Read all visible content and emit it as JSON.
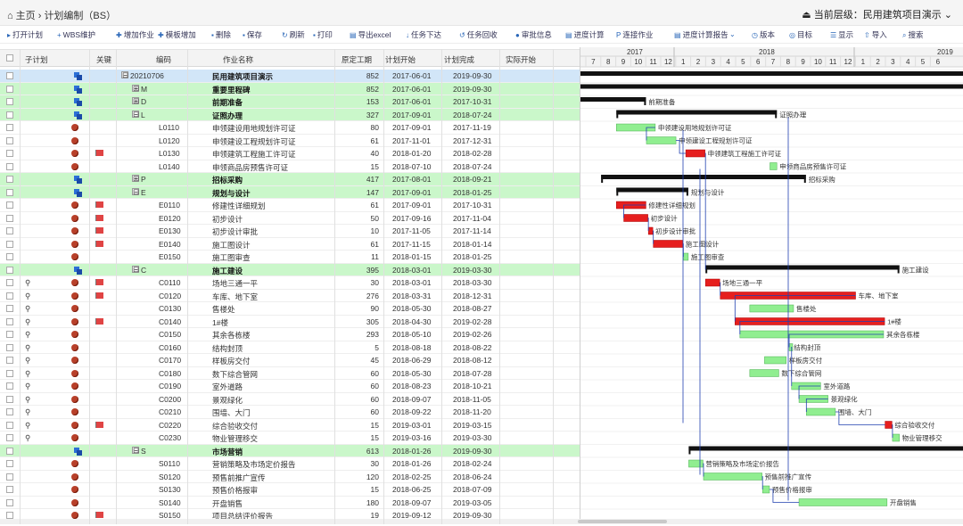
{
  "breadcrumb": {
    "home": "主页",
    "page": "计划编制（BS）"
  },
  "current_layer": "当前层级：民用建筑项目演示",
  "toolbar": [
    {
      "icon": "open-plan-icon",
      "glyph": "▸",
      "label": "打开计划"
    },
    {
      "icon": "plus-icon",
      "glyph": "+",
      "label": "WBS维护"
    },
    {
      "icon": "add-task-icon",
      "glyph": "✚",
      "label": "增加作业"
    },
    {
      "icon": "template-icon",
      "glyph": "✚",
      "label": "模板增加"
    },
    {
      "icon": "delete-icon",
      "glyph": "▪",
      "label": "删除"
    },
    {
      "icon": "save-icon",
      "glyph": "▪",
      "label": "保存"
    },
    {
      "icon": "refresh-icon",
      "glyph": "↻",
      "label": "刷新"
    },
    {
      "icon": "print-icon",
      "glyph": "▪",
      "label": "打印"
    },
    {
      "icon": "export-icon",
      "glyph": "▤",
      "label": "导出excel"
    },
    {
      "icon": "arrow-down-icon",
      "glyph": "↓",
      "label": "任务下达"
    },
    {
      "icon": "task-recall-icon",
      "glyph": "↺",
      "label": "任务回收"
    },
    {
      "icon": "info-icon",
      "glyph": "●",
      "label": "审批信息"
    },
    {
      "icon": "calc-icon",
      "glyph": "▤",
      "label": "进度计算"
    },
    {
      "icon": "link-icon",
      "glyph": "P",
      "label": "连接作业"
    },
    {
      "icon": "report-icon",
      "glyph": "▤",
      "label": "进度计算报告"
    },
    {
      "icon": "chevron-down-icon",
      "glyph": "⌄",
      "label": ""
    },
    {
      "icon": "version-icon",
      "glyph": "◷",
      "label": "版本"
    },
    {
      "icon": "target-icon",
      "glyph": "◎",
      "label": "目标"
    },
    {
      "icon": "display-icon",
      "glyph": "☰",
      "label": "显示"
    },
    {
      "icon": "import-icon",
      "glyph": "⇧",
      "label": "导入"
    },
    {
      "icon": "search-icon",
      "glyph": "⌕",
      "label": "搜索"
    }
  ],
  "columns": [
    "子计划",
    "关键",
    "编码",
    "作业名称",
    "原定工期",
    "计划开始",
    "计划完成",
    "实际开始"
  ],
  "timeline": {
    "years": [
      {
        "label": "2017"
      },
      {
        "label": "2018"
      },
      {
        "label": "2019"
      }
    ],
    "months": [
      "7",
      "8",
      "9",
      "10",
      "11",
      "12",
      "1",
      "2",
      "3",
      "4",
      "5",
      "6",
      "7",
      "8",
      "9",
      "10",
      "11",
      "12",
      "1",
      "2",
      "3",
      "4",
      "5",
      "6"
    ]
  },
  "rows": [
    {
      "type": "root",
      "icon": "wbs",
      "expander": "⊟",
      "code": "20210706",
      "name": "民用建筑项目演示",
      "dur": "852",
      "start": "2017-06-01",
      "finish": "2019-09-30"
    },
    {
      "type": "summary",
      "icon": "wbs",
      "expander": "⊞",
      "code": "M",
      "name": "重要里程碑",
      "dur": "852",
      "start": "2017-06-01",
      "finish": "2019-09-30"
    },
    {
      "type": "summary",
      "icon": "wbs",
      "expander": "⊞",
      "code": "D",
      "name": "前期准备",
      "dur": "153",
      "start": "2017-06-01",
      "finish": "2017-10-31"
    },
    {
      "type": "summary",
      "icon": "wbs",
      "expander": "⊟",
      "code": "L",
      "name": "证照办理",
      "dur": "327",
      "start": "2017-09-01",
      "finish": "2018-07-24"
    },
    {
      "type": "task",
      "icon": "act",
      "code": "L0110",
      "name": "申领建设用地规划许可证",
      "dur": "80",
      "start": "2017-09-01",
      "finish": "2017-11-19"
    },
    {
      "type": "task",
      "icon": "act",
      "code": "L0120",
      "name": "申领建设工程规划许可证",
      "dur": "61",
      "start": "2017-11-01",
      "finish": "2017-12-31"
    },
    {
      "type": "task",
      "icon": "act",
      "flag": true,
      "code": "L0130",
      "name": "申领建筑工程施工许可证",
      "dur": "40",
      "start": "2018-01-20",
      "finish": "2018-02-28"
    },
    {
      "type": "task",
      "icon": "act",
      "code": "L0140",
      "name": "申领商品房预售许可证",
      "dur": "15",
      "start": "2018-07-10",
      "finish": "2018-07-24"
    },
    {
      "type": "summary",
      "icon": "wbs",
      "expander": "⊞",
      "code": "P",
      "name": "招标采购",
      "dur": "417",
      "start": "2017-08-01",
      "finish": "2018-09-21"
    },
    {
      "type": "summary",
      "icon": "wbs",
      "expander": "⊟",
      "code": "E",
      "name": "规划与设计",
      "dur": "147",
      "start": "2017-09-01",
      "finish": "2018-01-25"
    },
    {
      "type": "task",
      "icon": "act",
      "flag": true,
      "code": "E0110",
      "name": "修建性详细规划",
      "dur": "61",
      "start": "2017-09-01",
      "finish": "2017-10-31"
    },
    {
      "type": "task",
      "icon": "act",
      "flag": true,
      "code": "E0120",
      "name": "初步设计",
      "dur": "50",
      "start": "2017-09-16",
      "finish": "2017-11-04"
    },
    {
      "type": "task",
      "icon": "act",
      "flag": true,
      "code": "E0130",
      "name": "初步设计审批",
      "dur": "10",
      "start": "2017-11-05",
      "finish": "2017-11-14"
    },
    {
      "type": "task",
      "icon": "act",
      "flag": true,
      "code": "E0140",
      "name": "施工图设计",
      "dur": "61",
      "start": "2017-11-15",
      "finish": "2018-01-14"
    },
    {
      "type": "task",
      "icon": "act",
      "code": "E0150",
      "name": "施工图审查",
      "dur": "11",
      "start": "2018-01-15",
      "finish": "2018-01-25"
    },
    {
      "type": "summary",
      "icon": "wbs",
      "expander": "⊟",
      "code": "C",
      "name": "施工建设",
      "dur": "395",
      "start": "2018-03-01",
      "finish": "2019-03-30"
    },
    {
      "type": "task",
      "icon": "act",
      "link": true,
      "flag": true,
      "code": "C0110",
      "name": "场地三通一平",
      "dur": "30",
      "start": "2018-03-01",
      "finish": "2018-03-30"
    },
    {
      "type": "task",
      "icon": "act",
      "link": true,
      "flag": true,
      "code": "C0120",
      "name": "车库、地下室",
      "dur": "276",
      "start": "2018-03-31",
      "finish": "2018-12-31"
    },
    {
      "type": "task",
      "icon": "act",
      "link": true,
      "code": "C0130",
      "name": "售楼处",
      "dur": "90",
      "start": "2018-05-30",
      "finish": "2018-08-27"
    },
    {
      "type": "task",
      "icon": "act",
      "link": true,
      "flag": true,
      "code": "C0140",
      "name": "1#楼",
      "dur": "305",
      "start": "2018-04-30",
      "finish": "2019-02-28"
    },
    {
      "type": "task",
      "icon": "act",
      "link": true,
      "code": "C0150",
      "name": "其余各栋楼",
      "dur": "293",
      "start": "2018-05-10",
      "finish": "2019-02-26"
    },
    {
      "type": "task",
      "icon": "act",
      "link": true,
      "code": "C0160",
      "name": "结构封顶",
      "dur": "5",
      "start": "2018-08-18",
      "finish": "2018-08-22"
    },
    {
      "type": "task",
      "icon": "act",
      "link": true,
      "code": "C0170",
      "name": "样板房交付",
      "dur": "45",
      "start": "2018-06-29",
      "finish": "2018-08-12"
    },
    {
      "type": "task",
      "icon": "act",
      "link": true,
      "code": "C0180",
      "name": "数下综合管网",
      "dur": "60",
      "start": "2018-05-30",
      "finish": "2018-07-28"
    },
    {
      "type": "task",
      "icon": "act",
      "link": true,
      "code": "C0190",
      "name": "室外道路",
      "dur": "60",
      "start": "2018-08-23",
      "finish": "2018-10-21"
    },
    {
      "type": "task",
      "icon": "act",
      "link": true,
      "code": "C0200",
      "name": "景观绿化",
      "dur": "60",
      "start": "2018-09-07",
      "finish": "2018-11-05"
    },
    {
      "type": "task",
      "icon": "act",
      "link": true,
      "code": "C0210",
      "name": "围墙、大门",
      "dur": "60",
      "start": "2018-09-22",
      "finish": "2018-11-20"
    },
    {
      "type": "task",
      "icon": "act",
      "link": true,
      "flag": true,
      "code": "C0220",
      "name": "综合验收交付",
      "dur": "15",
      "start": "2019-03-01",
      "finish": "2019-03-15"
    },
    {
      "type": "task",
      "icon": "act",
      "link": true,
      "code": "C0230",
      "name": "物业管理移交",
      "dur": "15",
      "start": "2019-03-16",
      "finish": "2019-03-30"
    },
    {
      "type": "summary",
      "icon": "wbs",
      "expander": "⊟",
      "code": "S",
      "name": "市场营销",
      "dur": "613",
      "start": "2018-01-26",
      "finish": "2019-09-30"
    },
    {
      "type": "task",
      "icon": "act",
      "code": "S0110",
      "name": "营销策略及市场定价报告",
      "dur": "30",
      "start": "2018-01-26",
      "finish": "2018-02-24"
    },
    {
      "type": "task",
      "icon": "act",
      "code": "S0120",
      "name": "预售前推广宣传",
      "dur": "120",
      "start": "2018-02-25",
      "finish": "2018-06-24"
    },
    {
      "type": "task",
      "icon": "act",
      "code": "S0130",
      "name": "预售价格报审",
      "dur": "15",
      "start": "2018-06-25",
      "finish": "2018-07-09"
    },
    {
      "type": "task",
      "icon": "act",
      "code": "S0140",
      "name": "开盘销售",
      "dur": "180",
      "start": "2018-09-07",
      "finish": "2019-03-05"
    },
    {
      "type": "task",
      "icon": "act",
      "flag": true,
      "code": "S0150",
      "name": "项目总结评价报告",
      "dur": "19",
      "start": "2019-09-12",
      "finish": "2019-09-30"
    }
  ],
  "gantt_bars": [
    {
      "row": 0,
      "start": "2017-06-01",
      "finish": "2019-09-30",
      "kind": "summary",
      "label": ""
    },
    {
      "row": 1,
      "start": "2017-06-01",
      "finish": "2019-09-30",
      "kind": "summary",
      "label": ""
    },
    {
      "row": 2,
      "start": "2017-06-01",
      "finish": "2017-10-31",
      "kind": "summary",
      "label": "前期准备"
    },
    {
      "row": 3,
      "start": "2017-09-01",
      "finish": "2018-07-24",
      "kind": "summary",
      "label": "证照办理"
    },
    {
      "row": 4,
      "start": "2017-09-01",
      "finish": "2017-11-19",
      "kind": "normal",
      "label": "申领建设用地规划许可证"
    },
    {
      "row": 5,
      "start": "2017-11-01",
      "finish": "2017-12-31",
      "kind": "normal",
      "label": "申领建设工程规划许可证"
    },
    {
      "row": 6,
      "start": "2018-01-20",
      "finish": "2018-02-28",
      "kind": "critical",
      "label": "申领建筑工程施工许可证"
    },
    {
      "row": 7,
      "start": "2018-07-10",
      "finish": "2018-07-24",
      "kind": "normal",
      "label": "申领商品房预售许可证"
    },
    {
      "row": 8,
      "start": "2017-08-01",
      "finish": "2018-09-21",
      "kind": "summary",
      "label": "招标采购"
    },
    {
      "row": 9,
      "start": "2017-09-01",
      "finish": "2018-01-25",
      "kind": "summary",
      "label": "规划与设计"
    },
    {
      "row": 10,
      "start": "2017-09-01",
      "finish": "2017-10-31",
      "kind": "critical",
      "label": "修建性详细规划"
    },
    {
      "row": 11,
      "start": "2017-09-16",
      "finish": "2017-11-04",
      "kind": "critical",
      "label": "初步设计"
    },
    {
      "row": 12,
      "start": "2017-11-05",
      "finish": "2017-11-14",
      "kind": "critical",
      "label": "初步设计审批"
    },
    {
      "row": 13,
      "start": "2017-11-15",
      "finish": "2018-01-14",
      "kind": "critical",
      "label": "施工图设计"
    },
    {
      "row": 14,
      "start": "2018-01-15",
      "finish": "2018-01-25",
      "kind": "normal",
      "label": "施工图审查"
    },
    {
      "row": 15,
      "start": "2018-03-01",
      "finish": "2019-03-30",
      "kind": "summary",
      "label": "施工建设"
    },
    {
      "row": 16,
      "start": "2018-03-01",
      "finish": "2018-03-30",
      "kind": "critical",
      "label": "场地三通一平"
    },
    {
      "row": 17,
      "start": "2018-03-31",
      "finish": "2018-12-31",
      "kind": "critical",
      "label": "车库、地下室"
    },
    {
      "row": 18,
      "start": "2018-05-30",
      "finish": "2018-08-27",
      "kind": "normal",
      "label": "售楼处"
    },
    {
      "row": 19,
      "start": "2018-04-30",
      "finish": "2019-02-28",
      "kind": "critical",
      "label": "1#楼"
    },
    {
      "row": 20,
      "start": "2018-05-10",
      "finish": "2019-02-26",
      "kind": "normal",
      "label": "其余各栋楼"
    },
    {
      "row": 21,
      "start": "2018-08-18",
      "finish": "2018-08-22",
      "kind": "normal",
      "label": "结构封顶"
    },
    {
      "row": 22,
      "start": "2018-06-29",
      "finish": "2018-08-12",
      "kind": "normal",
      "label": "样板房交付"
    },
    {
      "row": 23,
      "start": "2018-05-30",
      "finish": "2018-07-28",
      "kind": "normal",
      "label": "数下综合管网"
    },
    {
      "row": 24,
      "start": "2018-08-23",
      "finish": "2018-10-21",
      "kind": "normal",
      "label": "室外道路"
    },
    {
      "row": 25,
      "start": "2018-09-07",
      "finish": "2018-11-05",
      "kind": "normal",
      "label": "景观绿化"
    },
    {
      "row": 26,
      "start": "2018-09-22",
      "finish": "2018-11-20",
      "kind": "normal",
      "label": "围墙、大门"
    },
    {
      "row": 27,
      "start": "2019-03-01",
      "finish": "2019-03-15",
      "kind": "critical",
      "label": "综合验收交付"
    },
    {
      "row": 28,
      "start": "2019-03-16",
      "finish": "2019-03-30",
      "kind": "normal",
      "label": "物业管理移交"
    },
    {
      "row": 29,
      "start": "2018-01-26",
      "finish": "2019-09-30",
      "kind": "summary",
      "label": ""
    },
    {
      "row": 30,
      "start": "2018-01-26",
      "finish": "2018-02-24",
      "kind": "normal",
      "label": "营销策略及市场定价报告"
    },
    {
      "row": 31,
      "start": "2018-02-25",
      "finish": "2018-06-24",
      "kind": "normal",
      "label": "预售前推广宣传"
    },
    {
      "row": 32,
      "start": "2018-06-25",
      "finish": "2018-07-09",
      "kind": "normal",
      "label": "预售价格报审"
    },
    {
      "row": 33,
      "start": "2018-09-07",
      "finish": "2019-03-05",
      "kind": "normal",
      "label": "开盘销售"
    }
  ],
  "colors": {
    "critical": "#e61e1e",
    "normal": "#90ee90",
    "summary": "#111111",
    "link": "#2040b0",
    "root_row": "#d2e6f8",
    "summary_row": "#caf7ca"
  }
}
